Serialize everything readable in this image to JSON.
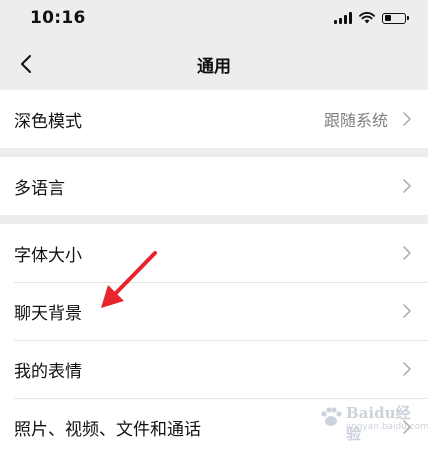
{
  "status_bar": {
    "time": "10:16",
    "signal_icon": "cellular-signal-icon",
    "wifi_icon": "wifi-icon",
    "battery_icon": "battery-icon",
    "battery_level": 0.35
  },
  "nav": {
    "back_icon": "chevron-left-icon",
    "title": "通用"
  },
  "groups": [
    {
      "items": [
        {
          "label": "深色模式",
          "value": "跟随系统"
        }
      ]
    },
    {
      "items": [
        {
          "label": "多语言"
        }
      ]
    },
    {
      "items": [
        {
          "label": "字体大小"
        },
        {
          "label": "聊天背景"
        },
        {
          "label": "我的表情"
        },
        {
          "label": "照片、视频、文件和通话"
        }
      ]
    }
  ],
  "annotation": {
    "arrow_color": "#e8242c"
  },
  "watermark": {
    "text": "Baidu经验",
    "sub": "jingyan.baidu.com"
  },
  "colors": {
    "background": "#ededed",
    "cell": "#ffffff",
    "secondary_text": "#808080",
    "chevron": "#b2b2b2"
  }
}
